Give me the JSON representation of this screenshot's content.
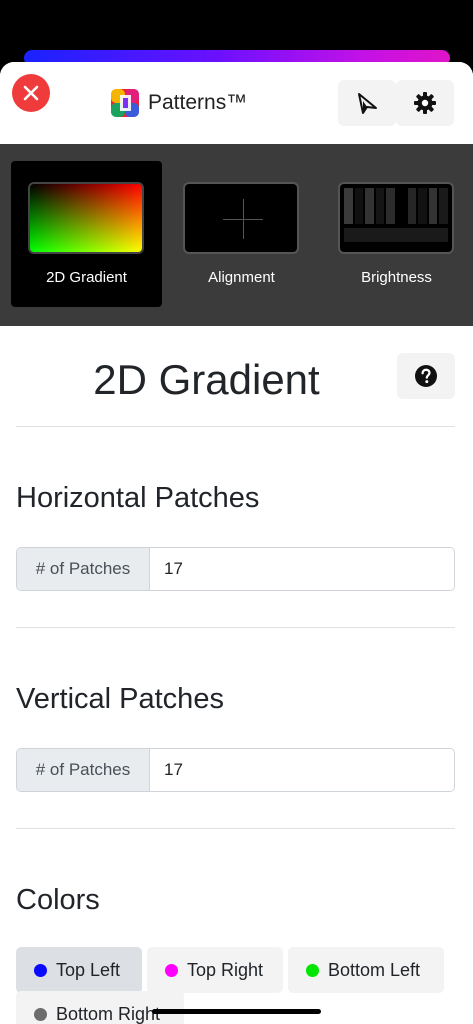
{
  "header": {
    "app_title": "Patterns™",
    "close_icon": "close-icon",
    "cast_icon": "cast-icon",
    "settings_icon": "gear-icon"
  },
  "patterns": [
    {
      "label": "2D Gradient",
      "selected": true
    },
    {
      "label": "Alignment",
      "selected": false
    },
    {
      "label": "Brightness",
      "selected": false
    }
  ],
  "main": {
    "title": "2D Gradient",
    "help_icon": "help-icon"
  },
  "horizontal": {
    "title": "Horizontal Patches",
    "label": "# of Patches",
    "value": "17"
  },
  "vertical": {
    "title": "Vertical Patches",
    "label": "# of Patches",
    "value": "17"
  },
  "colors": {
    "title": "Colors",
    "items": [
      {
        "label": "Top Left",
        "color": "#0a0aff",
        "active": true
      },
      {
        "label": "Top Right",
        "color": "#ff00ff",
        "active": false
      },
      {
        "label": "Bottom Left",
        "color": "#00e600",
        "active": false
      },
      {
        "label": "Bottom Right",
        "color": "#6c6c6c",
        "active": false
      }
    ]
  },
  "accent_colors": {
    "close": "#ef3b3b",
    "bar_start": "#1a22ff",
    "bar_end": "#e014c8"
  }
}
